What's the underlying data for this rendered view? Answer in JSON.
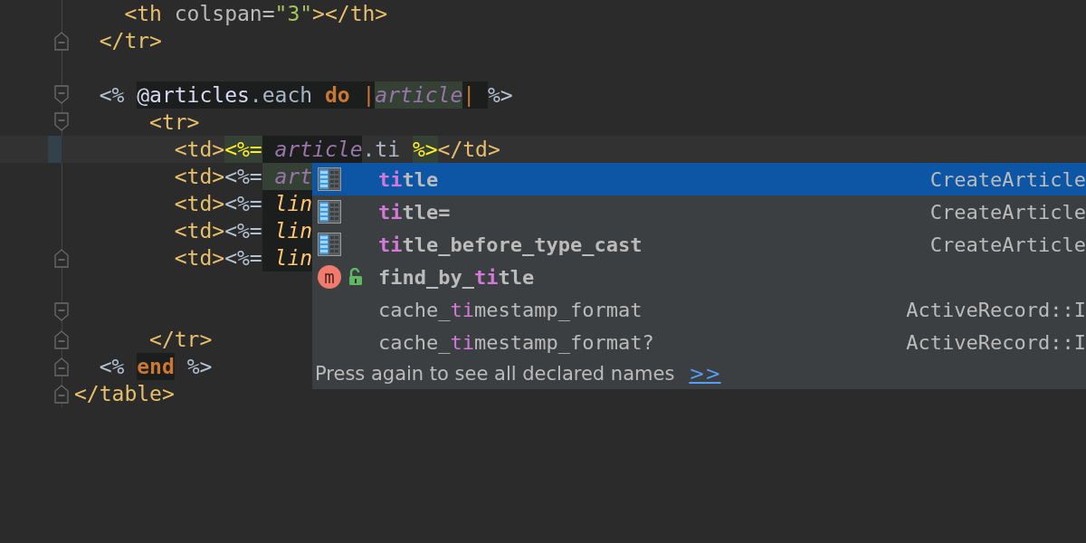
{
  "editor": {
    "lines": [
      {
        "children": [
          {
            "children": [
              {
                "tokens": [
                  {
                    "kind": "tag",
                    "text": "<th"
                  },
                  {
                    "kind": "attr",
                    "text": " colspan="
                  },
                  {
                    "kind": "string",
                    "text": "\"3\""
                  },
                  {
                    "kind": "tag",
                    "text": "></th>"
                  }
                ]
              }
            ]
          },
          {
            "kind": "closer",
            "tokens": [
              {
                "kind": "tag",
                "text": "</tr>"
              }
            ]
          },
          {
            "kind": "blank"
          },
          {
            "kind": "opener",
            "tokens": [
              {
                "kind": "erb",
                "text": "<% "
              },
              {
                "kind": "ivar",
                "text": "@articles",
                "shaded": true
              },
              {
                "kind": "method",
                "text": ".each ",
                "shaded": true
              },
              {
                "kind": "keyword",
                "text": "do ",
                "shaded": true
              },
              {
                "kind": "pipe",
                "text": "|",
                "shaded": true
              },
              {
                "kind": "param",
                "text": "article",
                "highlighted": true
              },
              {
                "kind": "pipe",
                "text": "| ",
                "shaded": true
              },
              {
                "kind": "erb",
                "text": "%>"
              }
            ],
            "children": [
              {
                "children": [
                  {
                    "kind": "opener",
                    "tokens": [
                      {
                        "kind": "tag",
                        "text": "<tr>"
                      }
                    ],
                    "children": [
                      {
                        "current": true,
                        "tokens": [
                          {
                            "kind": "tag",
                            "text": "<td>"
                          },
                          {
                            "kind": "erb_match",
                            "text": "<%=",
                            "highlighted": true
                          },
                          {
                            "kind": "param",
                            "text": " article",
                            "shaded": true
                          },
                          {
                            "kind": "method",
                            "text": ".ti "
                          },
                          {
                            "kind": "erb_match",
                            "text": "%>",
                            "highlighted": true
                          },
                          {
                            "kind": "tag",
                            "text": "</td>"
                          }
                        ]
                      },
                      {
                        "tokens": [
                          {
                            "kind": "tag",
                            "text": "<td>"
                          },
                          {
                            "kind": "erb",
                            "text": "<%="
                          },
                          {
                            "kind": "param",
                            "text": " art",
                            "highlighted": true
                          }
                        ]
                      },
                      {
                        "tokens": [
                          {
                            "kind": "tag",
                            "text": "<td>"
                          },
                          {
                            "kind": "erb",
                            "text": "<%="
                          },
                          {
                            "kind": "call",
                            "text": " lin",
                            "shaded": true
                          }
                        ]
                      },
                      {
                        "tokens": [
                          {
                            "kind": "tag",
                            "text": "<td>"
                          },
                          {
                            "kind": "erb",
                            "text": "<%="
                          },
                          {
                            "kind": "call",
                            "text": " lin",
                            "shaded": true
                          }
                        ]
                      },
                      {
                        "kind": "closer",
                        "tokens": [
                          {
                            "kind": "tag",
                            "text": "<td>"
                          },
                          {
                            "kind": "erb",
                            "text": "<%="
                          },
                          {
                            "kind": "call",
                            "text": " lin",
                            "shaded": true
                          }
                        ]
                      },
                      {
                        "kind": "blank"
                      },
                      {
                        "kind": "opener"
                      }
                    ]
                  },
                  {
                    "kind": "closer",
                    "tokens": [
                      {
                        "kind": "tag",
                        "text": "</tr>"
                      }
                    ]
                  }
                ]
              }
            ]
          },
          {
            "kind": "closer",
            "tokens": [
              {
                "kind": "erb",
                "text": "<% "
              },
              {
                "kind": "keyword",
                "text": "end",
                "shaded": true
              },
              {
                "kind": "erb",
                "text": " %>"
              }
            ]
          }
        ]
      },
      {
        "kind": "closer",
        "tokens": [
          {
            "kind": "tag",
            "text": "</table>"
          }
        ]
      }
    ]
  },
  "completion": {
    "items": [
      {
        "kind": "field",
        "selected": true,
        "bold": true,
        "parts": [
          {
            "text": "ti",
            "match": true
          },
          {
            "text": "tle",
            "match": false
          }
        ],
        "type": "CreateArticle"
      },
      {
        "kind": "field",
        "selected": false,
        "bold": true,
        "parts": [
          {
            "text": "ti",
            "match": true
          },
          {
            "text": "tle=",
            "match": false
          }
        ],
        "type": "CreateArticle"
      },
      {
        "kind": "field",
        "selected": false,
        "bold": true,
        "parts": [
          {
            "text": "ti",
            "match": true
          },
          {
            "text": "tle_before_type_cast",
            "match": false
          }
        ],
        "type": "CreateArticle"
      },
      {
        "kind": "method",
        "badge": "m",
        "selected": false,
        "bold": true,
        "parts": [
          {
            "text": "find_by_",
            "match": false
          },
          {
            "text": "ti",
            "match": true
          },
          {
            "text": "tle",
            "match": false
          }
        ]
      },
      {
        "kind": "plain",
        "selected": false,
        "bold": false,
        "parts": [
          {
            "text": "cache_",
            "match": false
          },
          {
            "text": "ti",
            "match": true
          },
          {
            "text": "mestamp_format",
            "match": false
          }
        ],
        "type": "ActiveRecord::I"
      },
      {
        "kind": "plain",
        "selected": false,
        "bold": false,
        "parts": [
          {
            "text": "cache_",
            "match": false
          },
          {
            "text": "ti",
            "match": true
          },
          {
            "text": "mestamp_format?",
            "match": false
          }
        ],
        "type": "ActiveRecord::I"
      }
    ],
    "footer": {
      "text": "Press again to see all declared names",
      "link": ">>"
    }
  }
}
